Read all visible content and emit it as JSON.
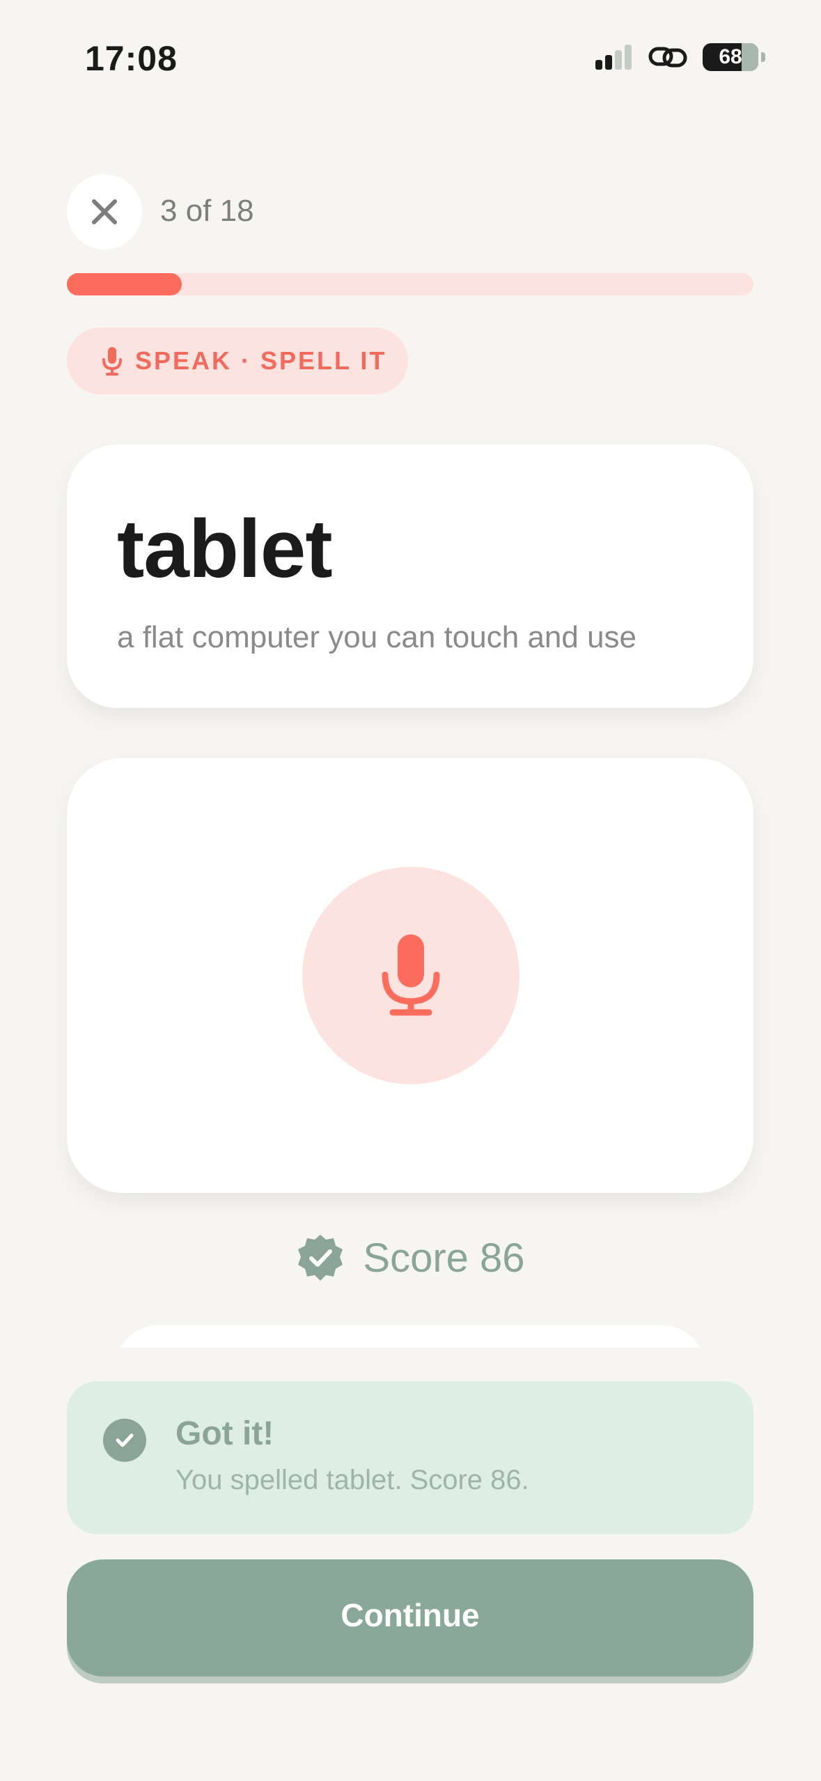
{
  "status_bar": {
    "time": "17:08",
    "battery": "68",
    "icons": [
      "signal-icon",
      "link-icon",
      "battery-icon"
    ]
  },
  "header": {
    "close_icon": "close-icon",
    "counter": "3 of 18",
    "progress": {
      "current": 3,
      "total": 18,
      "fraction": 0.167
    }
  },
  "mode": {
    "icon": "microphone-icon",
    "label": "SPEAK · SPELL IT"
  },
  "word_card": {
    "word": "tablet",
    "definition": "a flat computer you can touch and use"
  },
  "mic": {
    "icon": "microphone-icon"
  },
  "score": {
    "icon": "verified-badge-icon",
    "text": "Score 86"
  },
  "feedback": {
    "icon": "check-circle-icon",
    "title": "Got it!",
    "message": "You spelled tablet. Score 86."
  },
  "continue_label": "Continue",
  "colors": {
    "accent": "#fb6c5d",
    "accent_soft": "#fde3df",
    "success": "#8aa597",
    "success_soft": "#dfeee4",
    "background": "#f6f5f1"
  }
}
